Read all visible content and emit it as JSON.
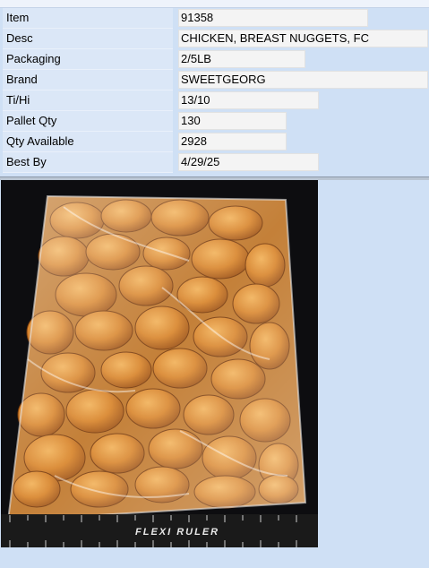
{
  "fields": [
    {
      "label": "Item",
      "value": "91358"
    },
    {
      "label": "Desc",
      "value": "CHICKEN, BREAST NUGGETS, FC"
    },
    {
      "label": "Packaging",
      "value": "2/5LB"
    },
    {
      "label": "Brand",
      "value": "SWEETGEORG"
    },
    {
      "label": "Ti/Hi",
      "value": "13/10"
    },
    {
      "label": "Pallet Qty",
      "value": "130"
    },
    {
      "label": "Qty Available",
      "value": "2928"
    },
    {
      "label": "Best By",
      "value": " 4/29/25"
    }
  ],
  "photo": {
    "ruler_text": "FLEXI RULER"
  },
  "colors": {
    "panel_bg": "#cfe0f5",
    "label_bg": "#dbe7f7",
    "field_bg": "#f4f4f4"
  }
}
